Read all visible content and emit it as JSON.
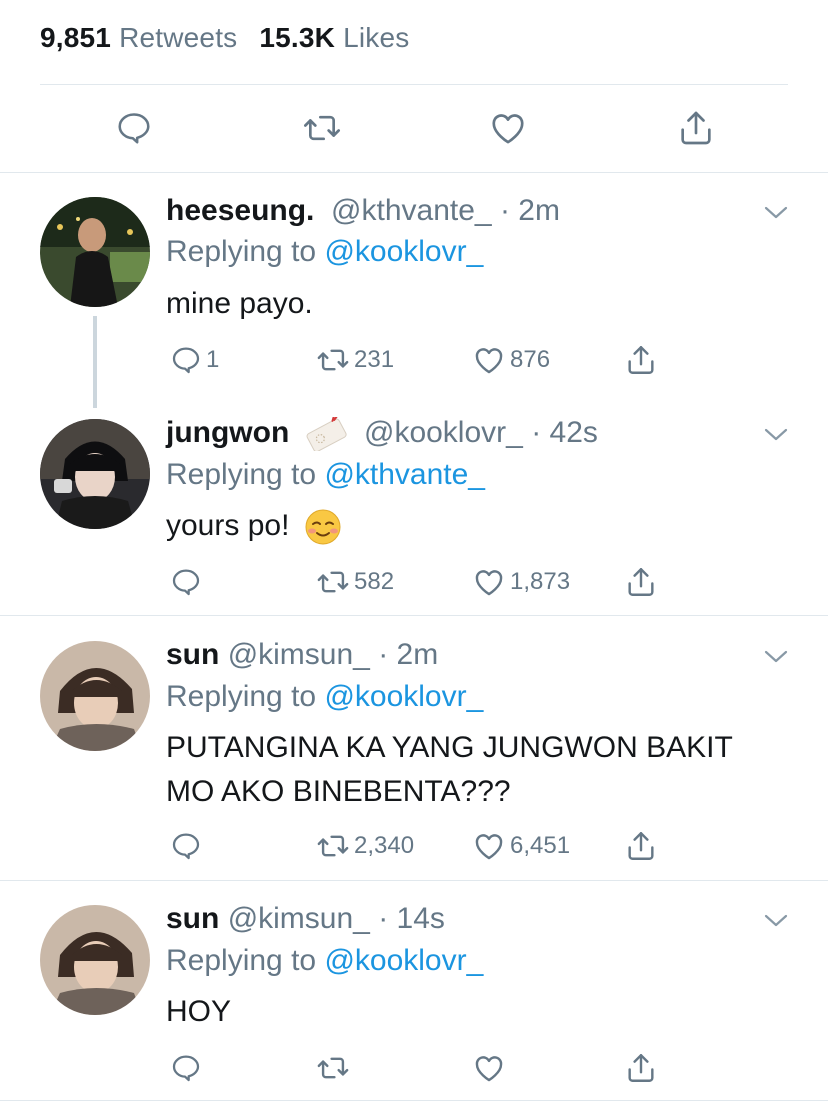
{
  "stats": {
    "retweets_count": "9,851",
    "retweets_label": "Retweets",
    "likes_count": "15.3K",
    "likes_label": "Likes"
  },
  "main_actions": [
    "reply-icon",
    "retweet-icon",
    "like-icon",
    "share-icon"
  ],
  "colors": {
    "text": "#14171a",
    "muted": "#657786",
    "link": "#1b95e0",
    "divider": "#e1e8ed",
    "icon": "#657786"
  },
  "replies": [
    {
      "name": "heeseung.",
      "handle": "@kthvante_",
      "time": "· 2m",
      "replying_label": "Replying to",
      "replying_to": "@kooklovr_",
      "text": "mine payo.",
      "reply_count": "1",
      "retweet_count": "231",
      "like_count": "876"
    },
    {
      "name": "jungwon",
      "handle": "@kooklovr_",
      "time": "· 42s",
      "replying_label": "Replying to",
      "replying_to": "@kthvante_",
      "text": "yours po!",
      "reply_count": "",
      "retweet_count": "582",
      "like_count": "1,873"
    },
    {
      "name": "sun",
      "handle": "@kimsun_",
      "time": "· 2m",
      "replying_label": "Replying to",
      "replying_to": "@kooklovr_",
      "text": "PUTANGINA KA YANG JUNGWON BAKIT MO AKO BINEBENTA???",
      "reply_count": "",
      "retweet_count": "2,340",
      "like_count": "6,451"
    },
    {
      "name": "sun",
      "handle": "@kimsun_",
      "time": "· 14s",
      "replying_label": "Replying to",
      "replying_to": "@kooklovr_",
      "text": "HOY",
      "reply_count": "",
      "retweet_count": "",
      "like_count": ""
    }
  ]
}
